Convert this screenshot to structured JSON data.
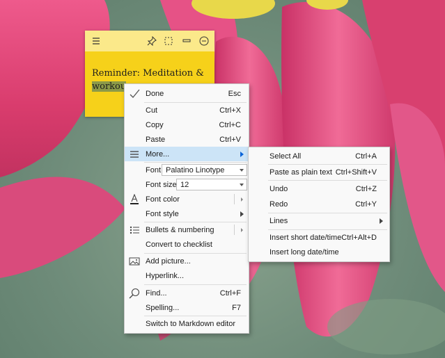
{
  "note": {
    "text_line1": "Reminder: Meditation &",
    "text_line2_highlighted": "workou",
    "toolbar_icons": [
      "hamburger-menu-icon",
      "pin-icon",
      "select-icon",
      "minimize-icon",
      "close-circle-icon"
    ]
  },
  "context_menu": {
    "done": {
      "label": "Done",
      "shortcut": "Esc",
      "icon": "checkmark-icon"
    },
    "cut": {
      "label": "Cut",
      "shortcut": "Ctrl+X"
    },
    "copy": {
      "label": "Copy",
      "shortcut": "Ctrl+C"
    },
    "paste": {
      "label": "Paste",
      "shortcut": "Ctrl+V"
    },
    "more": {
      "label": "More...",
      "icon": "list-icon"
    },
    "font": {
      "label": "Font",
      "value": "Palatino Linotype"
    },
    "font_size": {
      "label": "Font size",
      "value": "12"
    },
    "font_color": {
      "label": "Font color",
      "icon": "font-color-icon"
    },
    "font_style": {
      "label": "Font style"
    },
    "bullets": {
      "label": "Bullets & numbering",
      "icon": "bullets-icon"
    },
    "convert": {
      "label": "Convert to checklist"
    },
    "add_picture": {
      "label": "Add picture...",
      "icon": "picture-icon"
    },
    "hyperlink": {
      "label": "Hyperlink..."
    },
    "find": {
      "label": "Find...",
      "shortcut": "Ctrl+F",
      "icon": "search-icon"
    },
    "spelling": {
      "label": "Spelling...",
      "shortcut": "F7"
    },
    "markdown": {
      "label": "Switch to Markdown editor"
    }
  },
  "sub_menu": {
    "select_all": {
      "label": "Select All",
      "shortcut": "Ctrl+A"
    },
    "paste_plain": {
      "label": "Paste as plain text",
      "shortcut": "Ctrl+Shift+V"
    },
    "undo": {
      "label": "Undo",
      "shortcut": "Ctrl+Z"
    },
    "redo": {
      "label": "Redo",
      "shortcut": "Ctrl+Y"
    },
    "lines": {
      "label": "Lines"
    },
    "short_date": {
      "label": "Insert short date/time",
      "shortcut": "Ctrl+Alt+D"
    },
    "long_date": {
      "label": "Insert long date/time"
    }
  },
  "colors": {
    "note_yellow": "#f6d11a",
    "note_toolbar": "#fbe98a",
    "menu_highlight": "#cce4f7",
    "accent_blue": "#0a64d8",
    "petal_pink": "#e2457a"
  }
}
